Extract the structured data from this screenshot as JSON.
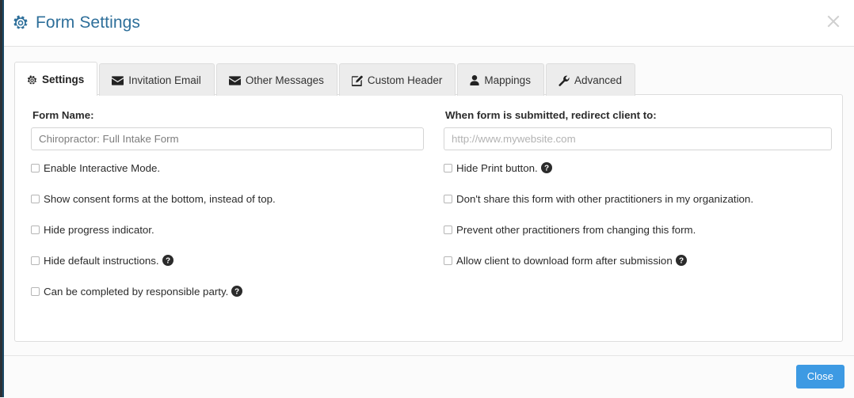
{
  "colors": {
    "title_blue": "#2e6f9a",
    "button_blue": "#3d9ae3",
    "panel_border": "#dddddd",
    "tab_inactive_bg": "#ececec",
    "body_bg": "#fbfbfb"
  },
  "header": {
    "title": "Form Settings",
    "gear_icon": "gear-icon",
    "close_icon": "close-icon"
  },
  "tabs": [
    {
      "label": "Settings",
      "icon": "gear-icon",
      "active": true
    },
    {
      "label": "Invitation Email",
      "icon": "envelope-icon",
      "active": false
    },
    {
      "label": "Other Messages",
      "icon": "envelope-icon",
      "active": false
    },
    {
      "label": "Custom Header",
      "icon": "edit-square-icon",
      "active": false
    },
    {
      "label": "Mappings",
      "icon": "user-icon",
      "active": false
    },
    {
      "label": "Advanced",
      "icon": "wrench-icon",
      "active": false
    }
  ],
  "settings_tab": {
    "form_name": {
      "label": "Form Name:",
      "value": "Chiropractor: Full Intake Form",
      "placeholder": "Chiropractor: Full Intake Form"
    },
    "redirect": {
      "label": "When form is submitted, redirect client to:",
      "value": "",
      "placeholder": "http://www.mywebsite.com"
    },
    "left_checkboxes": [
      {
        "label": "Enable Interactive Mode.",
        "checked": false,
        "help": false
      },
      {
        "label": "Show consent forms at the bottom, instead of top.",
        "checked": false,
        "help": false
      },
      {
        "label": "Hide progress indicator.",
        "checked": false,
        "help": false
      },
      {
        "label": "Hide default instructions.",
        "checked": false,
        "help": true
      },
      {
        "label": "Can be completed by responsible party.",
        "checked": false,
        "help": true
      }
    ],
    "right_checkboxes": [
      {
        "label": "Hide Print button.",
        "checked": false,
        "help": true
      },
      {
        "label": "Don't share this form with other practitioners in my organization.",
        "checked": false,
        "help": false
      },
      {
        "label": "Prevent other practitioners from changing this form.",
        "checked": false,
        "help": false
      },
      {
        "label": "Allow client to download form after submission",
        "checked": false,
        "help": true
      }
    ]
  },
  "footer": {
    "close_label": "Close"
  }
}
